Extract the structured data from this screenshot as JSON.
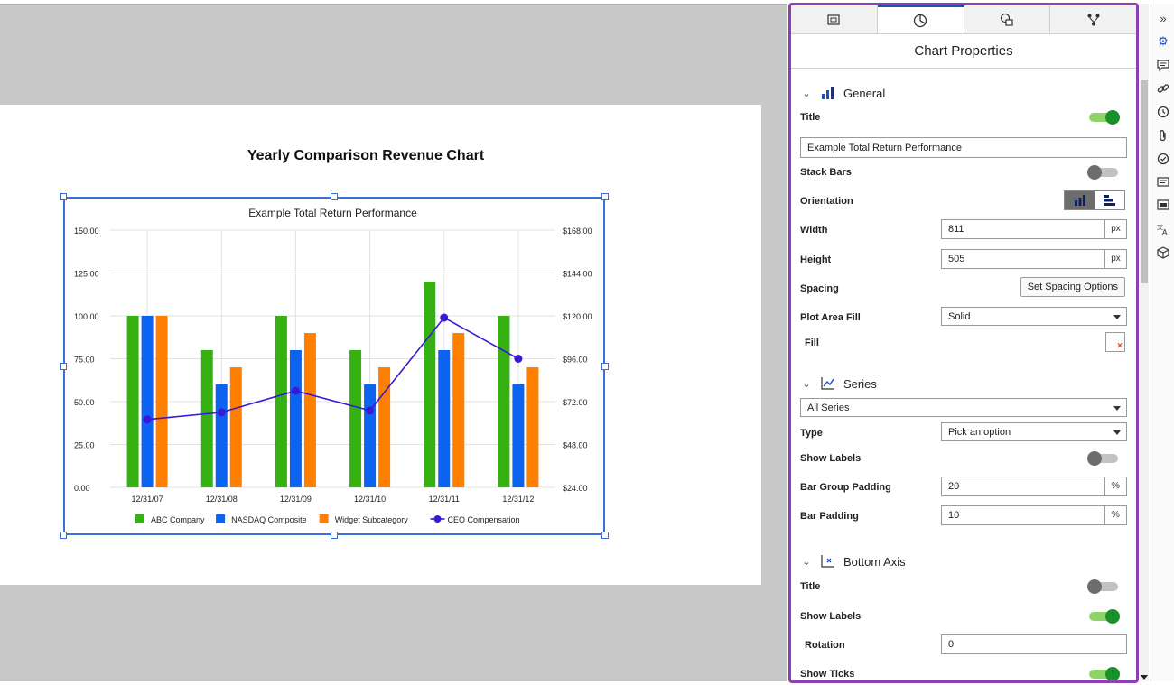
{
  "canvas": {
    "report_title": "Yearly Comparison Revenue Chart"
  },
  "chart_data": {
    "type": "bar",
    "title": "Example Total Return Performance",
    "categories": [
      "12/31/07",
      "12/31/08",
      "12/31/09",
      "12/31/10",
      "12/31/11",
      "12/31/12"
    ],
    "left_axis": {
      "ticks": [
        "150.00",
        "125.00",
        "100.00",
        "75.00",
        "50.00",
        "25.00",
        "0.00"
      ],
      "range": [
        0,
        150
      ]
    },
    "right_axis": {
      "ticks": [
        "$168.00",
        "$144.00",
        "$120.00",
        "$96.00",
        "$72.00",
        "$48.00",
        "$24.00"
      ],
      "range": [
        24,
        168
      ]
    },
    "series": [
      {
        "name": "ABC Company",
        "type": "bar",
        "color": "#35b211",
        "values": [
          100,
          80,
          100,
          80,
          120,
          100
        ]
      },
      {
        "name": "NASDAQ Composite",
        "type": "bar",
        "color": "#0c63f0",
        "values": [
          100,
          60,
          80,
          60,
          80,
          60
        ]
      },
      {
        "name": "Widget Subcategory",
        "type": "bar",
        "color": "#ff7f00",
        "values": [
          100,
          70,
          90,
          70,
          90,
          70
        ]
      },
      {
        "name": "CEO Compensation",
        "type": "line",
        "axis": "right",
        "color": "#3a18d8",
        "values": [
          62,
          66,
          78,
          67,
          119,
          96
        ]
      }
    ],
    "grid": true,
    "legend": "bottom"
  },
  "panel": {
    "tabs": [
      {
        "icon": "page-layout-icon"
      },
      {
        "icon": "pie-chart-icon"
      },
      {
        "icon": "shapes-icon"
      },
      {
        "icon": "data-mapping-icon"
      }
    ],
    "title": "Chart Properties",
    "general": {
      "label": "General",
      "title_label": "Title",
      "title_on": true,
      "title_value": "Example Total Return Performance",
      "stack_bars_label": "Stack Bars",
      "stack_bars_on": false,
      "orientation_label": "Orientation",
      "width_label": "Width",
      "width_value": "811",
      "width_unit": "px",
      "height_label": "Height",
      "height_value": "505",
      "height_unit": "px",
      "spacing_label": "Spacing",
      "spacing_button": "Set Spacing Options",
      "plot_area_fill_label": "Plot Area Fill",
      "plot_area_fill_value": "Solid",
      "fill_label": "Fill",
      "fill_mark": "×"
    },
    "series": {
      "label": "Series",
      "selector_value": "All Series",
      "type_label": "Type",
      "type_value": "Pick an option",
      "show_labels_label": "Show Labels",
      "show_labels_on": false,
      "bar_group_padding_label": "Bar Group Padding",
      "bar_group_padding_value": "20",
      "bar_group_padding_unit": "%",
      "bar_padding_label": "Bar Padding",
      "bar_padding_value": "10",
      "bar_padding_unit": "%"
    },
    "bottom_axis": {
      "label": "Bottom Axis",
      "title_label": "Title",
      "title_on": false,
      "show_labels_label": "Show Labels",
      "show_labels_on": true,
      "rotation_label": "Rotation",
      "rotation_value": "0",
      "show_ticks_label": "Show Ticks",
      "show_ticks_on": true
    }
  },
  "rail": {
    "icons": [
      "expand-icon",
      "settings-icon",
      "comments-icon",
      "link-icon",
      "history-icon",
      "attachment-icon",
      "tasks-icon",
      "notes-icon",
      "preview-icon",
      "translate-icon",
      "package-icon"
    ]
  }
}
